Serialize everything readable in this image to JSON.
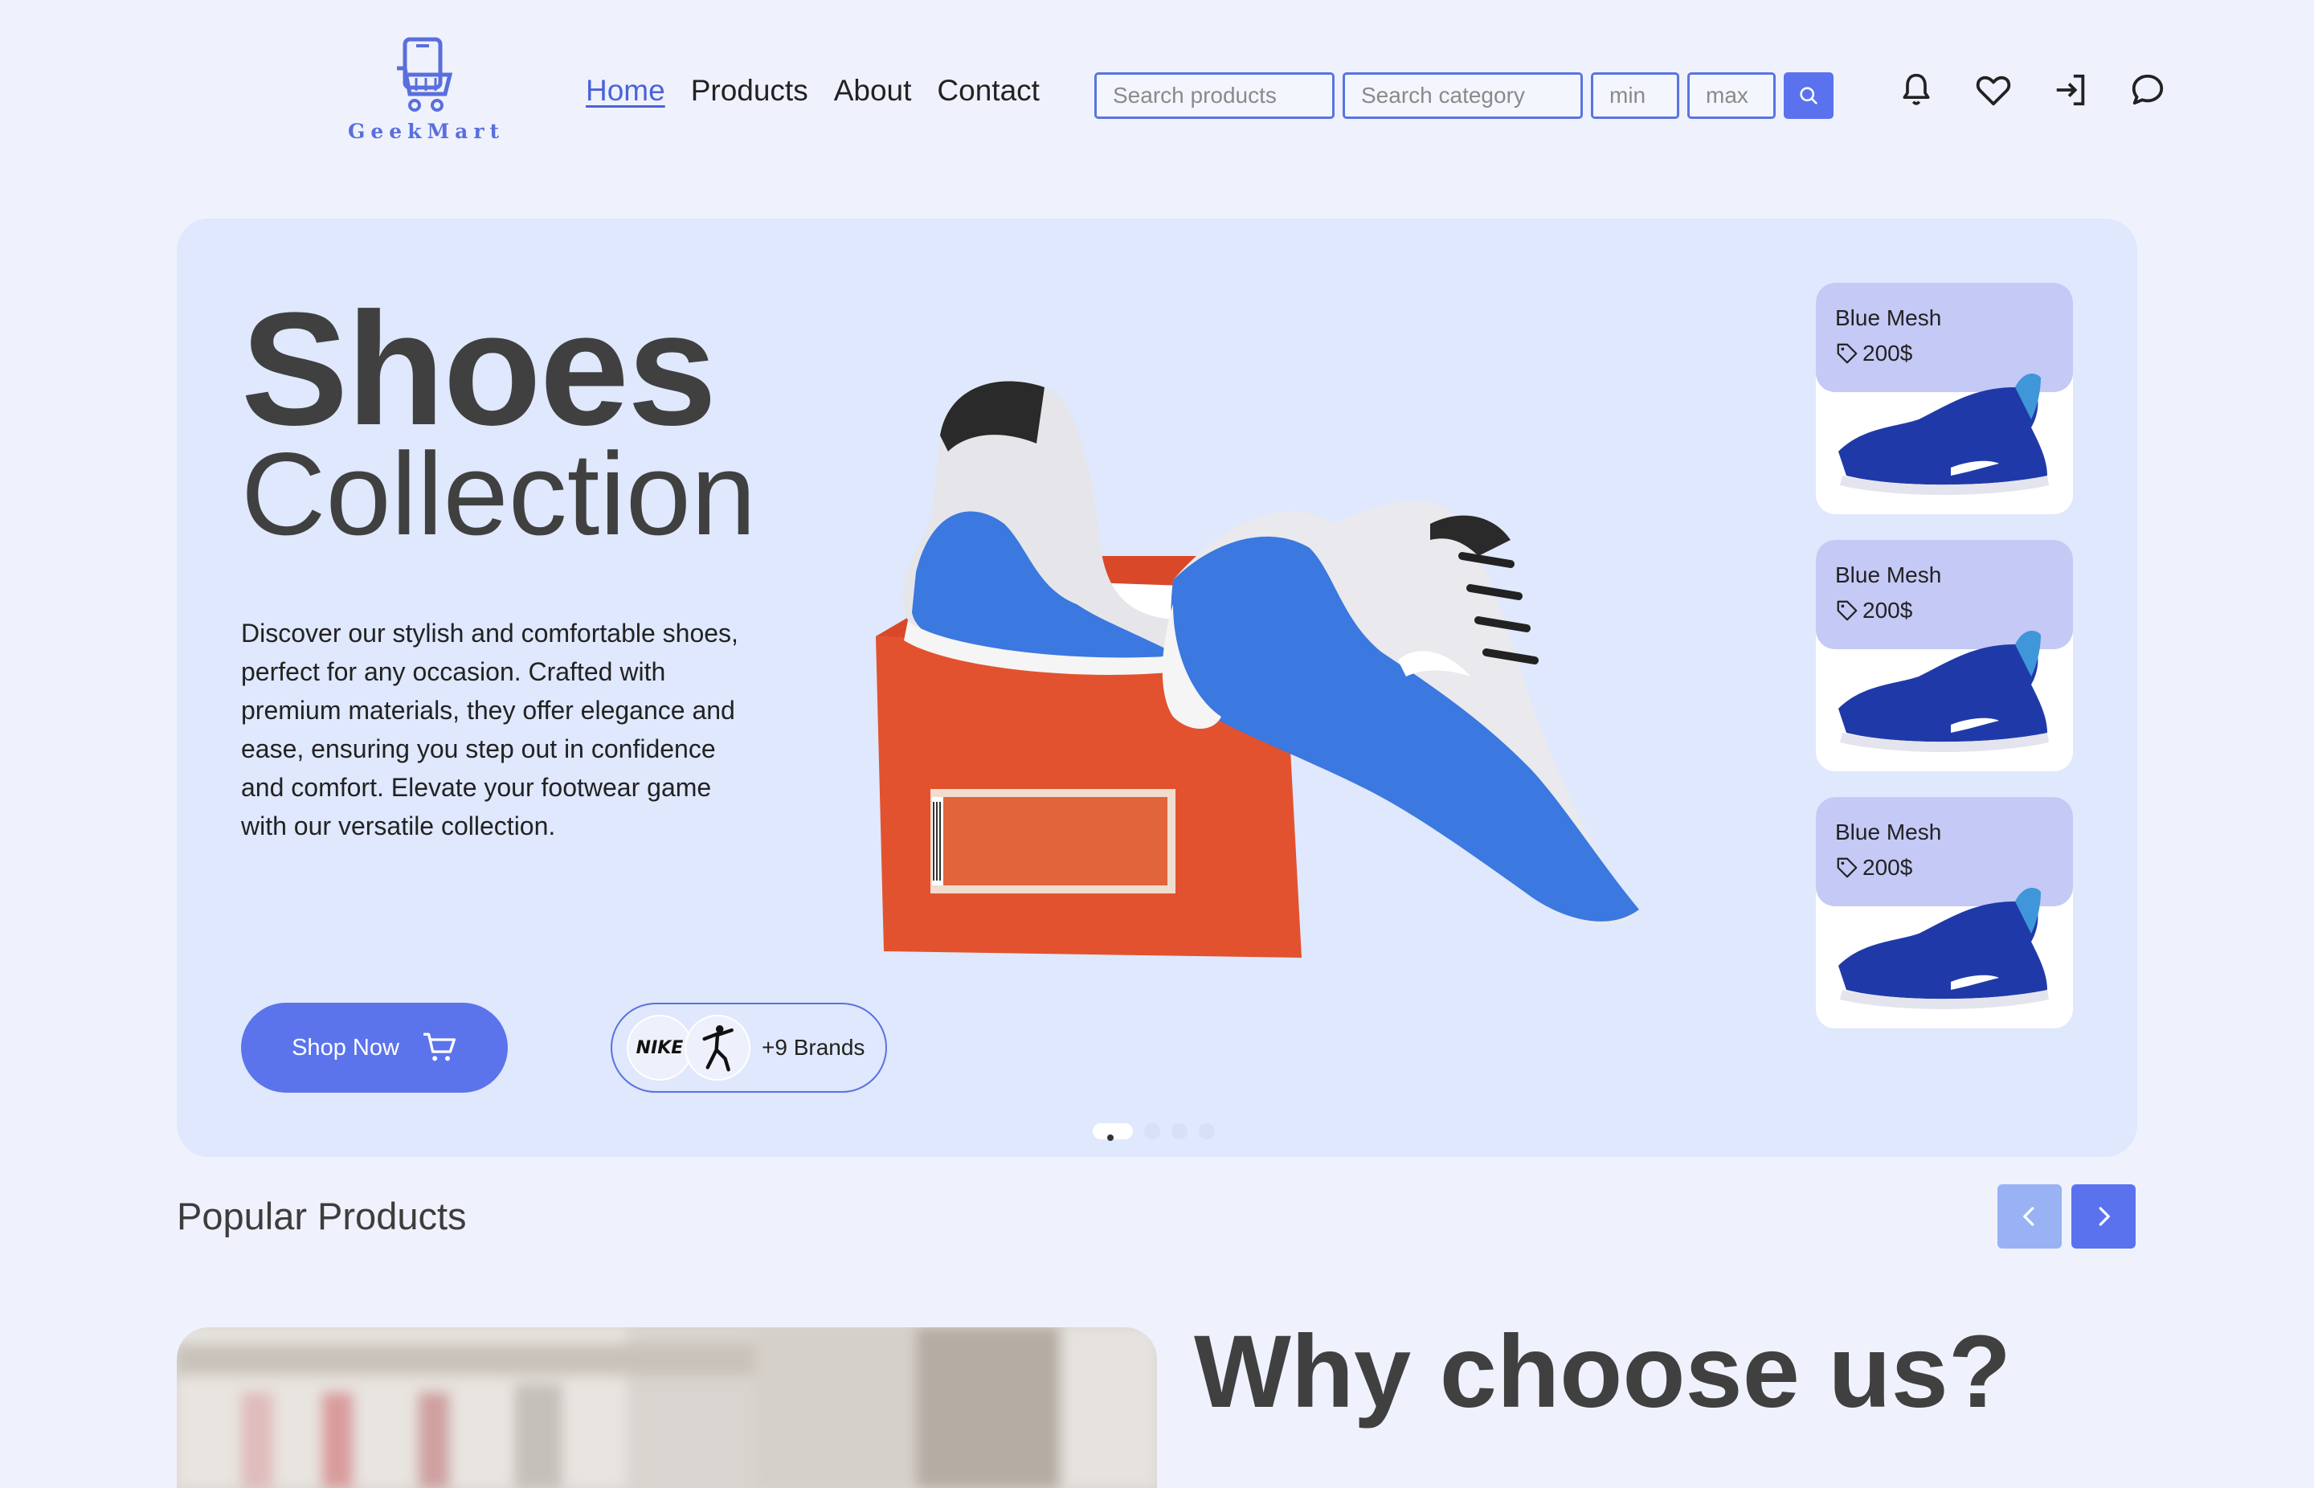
{
  "brand": {
    "name": "GeekMart"
  },
  "nav": [
    {
      "label": "Home",
      "active": true
    },
    {
      "label": "Products",
      "active": false
    },
    {
      "label": "About",
      "active": false
    },
    {
      "label": "Contact",
      "active": false
    }
  ],
  "search": {
    "products_placeholder": "Search products",
    "category_placeholder": "Search category",
    "min_placeholder": "min",
    "max_placeholder": "max"
  },
  "header_icons": [
    "bell-icon",
    "heart-icon",
    "login-icon",
    "chat-icon"
  ],
  "hero": {
    "title_line1": "Shoes",
    "title_line2": "Collection",
    "description": "Discover our stylish and comfortable shoes, perfect for any occasion. Crafted with premium materials, they offer elegance and ease, ensuring you step out in confidence and comfort. Elevate your footwear game with our versatile collection.",
    "shop_button": "Shop Now",
    "brands_more": "+9 Brands",
    "brand_logos": [
      "NIKE",
      "jumpman"
    ],
    "slides_total": 4,
    "active_slide": 1
  },
  "featured_cards": [
    {
      "name": "Blue Mesh",
      "price": "200$"
    },
    {
      "name": "Blue Mesh",
      "price": "200$"
    },
    {
      "name": "Blue Mesh",
      "price": "200$"
    }
  ],
  "popular": {
    "title": "Popular Products"
  },
  "why": {
    "title": "Why choose us?"
  },
  "colors": {
    "accent": "#5b74ec",
    "hero_bg": "#dfe8fc",
    "page_bg": "#eff2fd",
    "card_accent": "#c5c9f6"
  }
}
